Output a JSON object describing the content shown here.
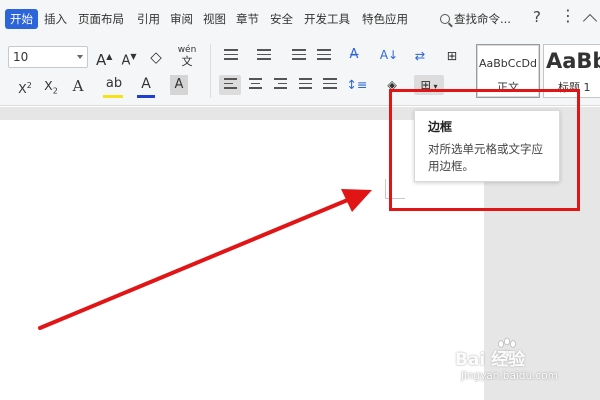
{
  "menu": {
    "tabs": [
      {
        "label": "开始",
        "active": true
      },
      {
        "label": "插入"
      },
      {
        "label": "页面布局"
      },
      {
        "label": "引用"
      },
      {
        "label": "审阅"
      },
      {
        "label": "视图"
      },
      {
        "label": "章节"
      },
      {
        "label": "安全"
      },
      {
        "label": "开发工具"
      },
      {
        "label": "特色应用"
      }
    ],
    "search_label": "查找命令...",
    "help_label": "?",
    "more_label": "⋮"
  },
  "toolbar": {
    "font_size": "10",
    "grow_font": "A",
    "shrink_font": "A",
    "clear_format": "◇",
    "phonetic": "wén",
    "superscript": "X",
    "subscript": "X",
    "text_effect": "A",
    "highlight": "ab",
    "font_color": "A",
    "char_shade": "A",
    "sort_label": "A↓",
    "colors": {
      "highlight": "#f5e11a",
      "font_color": "#1f3fd1",
      "accent": "#2b65d9"
    }
  },
  "styles": [
    {
      "sample": "AaBbCcDd",
      "name": "正文",
      "selected": true
    },
    {
      "sample": "AaBb",
      "name": "标题 1",
      "selected": false
    }
  ],
  "tooltip": {
    "title": "边框",
    "description": "对所选单元格或文字应用边框。"
  },
  "watermark": {
    "logo": "Bai  经验",
    "url": "jingyan.baidu.com"
  },
  "annotation_colors": {
    "arrow": "#e11515",
    "box": "#e11515"
  }
}
